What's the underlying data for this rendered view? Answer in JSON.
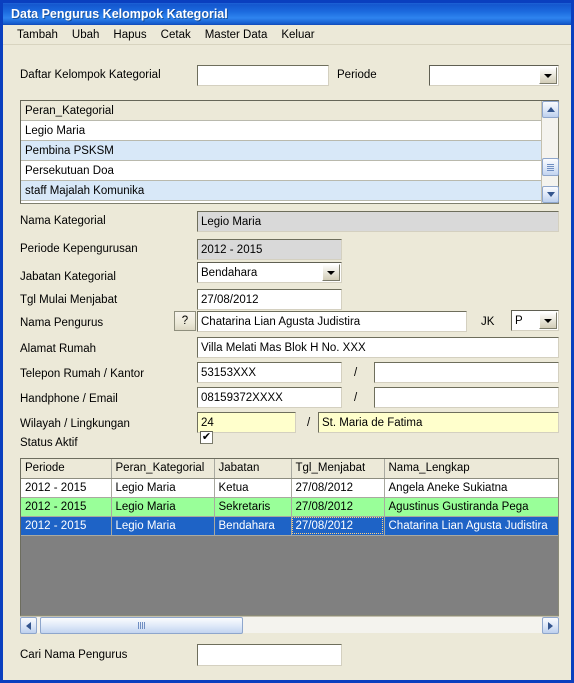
{
  "window": {
    "title": "Data Pengurus Kelompok Kategorial",
    "accent_color": "#1e62d6",
    "face_color": "#ece9d8"
  },
  "menu": {
    "items": [
      {
        "label": "Tambah"
      },
      {
        "label": "Ubah"
      },
      {
        "label": "Hapus"
      },
      {
        "label": "Cetak"
      },
      {
        "label": "Master Data"
      },
      {
        "label": "Keluar"
      }
    ]
  },
  "filter": {
    "daftar_label": "Daftar Kelompok Kategorial",
    "daftar_value": "",
    "daftar_placeholder": "",
    "periode_label": "Periode",
    "periode_value": "",
    "periode_placeholder": ""
  },
  "listbox": {
    "header": "Peran_Kategorial",
    "rows": [
      {
        "label": "Legio Maria",
        "selected": false
      },
      {
        "label": "Pembina PSKSM",
        "selected": true
      },
      {
        "label": "Persekutuan Doa",
        "selected": false
      },
      {
        "label": "staff Majalah Komunika",
        "selected": true
      }
    ],
    "scroll_position_percent": 62
  },
  "form": {
    "nama_kategorial_label": "Nama Kategorial",
    "nama_kategorial_value": "Legio Maria",
    "periode_kepengurusan_label": "Periode Kepengurusan",
    "periode_kepengurusan_value": "2012 - 2015",
    "jabatan_label": "Jabatan Kategorial",
    "jabatan_value": "Bendahara",
    "tgl_mulai_label": "Tgl Mulai Menjabat",
    "tgl_mulai_value": "27/08/2012",
    "nama_pengurus_label": "Nama Pengurus",
    "nama_pengurus_value": "Chatarina Lian Agusta Judistira",
    "lookup_button_label": "?",
    "jk_label": "JK",
    "jk_value": "P",
    "alamat_label": "Alamat Rumah",
    "alamat_value": "Villa Melati Mas Blok H No. XXX",
    "telepon_label": "Telepon Rumah  /  Kantor",
    "telepon_rumah_value": "53153XXX",
    "telepon_kantor_value": "",
    "handphone_label": "Handphone / Email",
    "handphone_value": "08159372XXXX",
    "email_value": "",
    "wilayah_label": "Wilayah  /  Lingkungan",
    "wilayah_value": "24",
    "lingkungan_value": "St. Maria de Fatima",
    "status_label": "Status Aktif",
    "status_checked": true,
    "separator": "/",
    "check_glyph": "✔"
  },
  "grid": {
    "columns": [
      "Periode",
      "Peran_Kategorial",
      "Jabatan",
      "Tgl_Menjabat",
      "Nama_Lengkap"
    ],
    "rows": [
      {
        "cells": [
          "2012 - 2015",
          "Legio Maria",
          "Ketua",
          "27/08/2012",
          "Angela  Aneke Sukiatna"
        ],
        "style": "white"
      },
      {
        "cells": [
          "2012 - 2015",
          "Legio Maria",
          "Sekretaris",
          "27/08/2012",
          "Agustinus  Gustiranda Pega"
        ],
        "style": "green"
      },
      {
        "cells": [
          "2012 - 2015",
          "Legio Maria",
          "Bendahara",
          "27/08/2012",
          "Chatarina Lian Agusta Judistira"
        ],
        "style": "blue"
      }
    ],
    "hscroll_position_percent": 8
  },
  "search": {
    "label": "Cari Nama Pengurus",
    "value": "",
    "placeholder": ""
  },
  "icons": {
    "scroll_up": "chevron-up-icon",
    "scroll_down": "chevron-down-icon",
    "scroll_left": "chevron-left-icon",
    "scroll_right": "chevron-right-icon",
    "dropdown": "caret-down-icon"
  }
}
